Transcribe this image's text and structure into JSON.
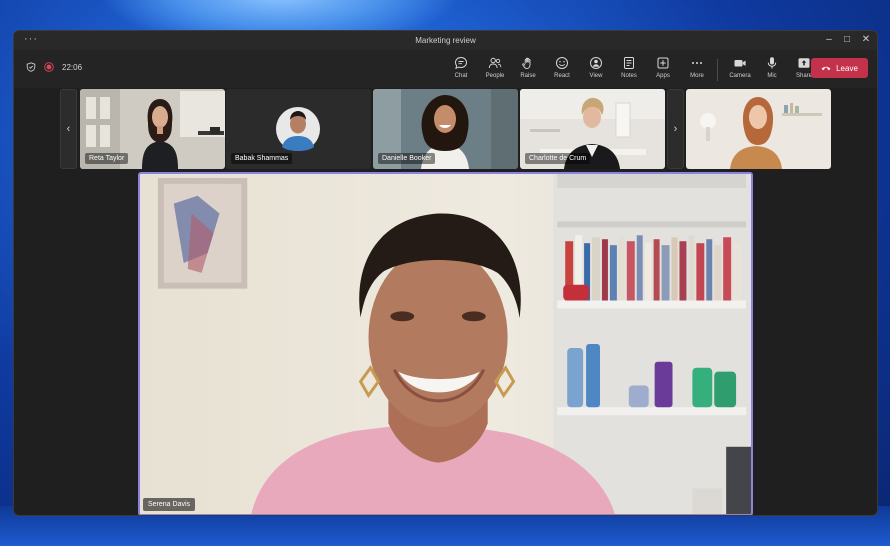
{
  "window": {
    "title": "Marketing review",
    "menu_glyph": "···",
    "minimize_glyph": "–",
    "maximize_glyph": "□",
    "close_glyph": "✕"
  },
  "call": {
    "duration": "22:06",
    "recording_color": "#e0455a"
  },
  "toolbar": {
    "buttons": [
      {
        "label": "Chat",
        "icon": "chat-icon"
      },
      {
        "label": "People",
        "icon": "people-icon"
      },
      {
        "label": "Raise",
        "icon": "raise-hand-icon"
      },
      {
        "label": "React",
        "icon": "react-icon"
      },
      {
        "label": "View",
        "icon": "view-icon"
      },
      {
        "label": "Notes",
        "icon": "notes-icon"
      },
      {
        "label": "Apps",
        "icon": "apps-icon"
      },
      {
        "label": "More",
        "icon": "more-icon"
      },
      {
        "label": "Camera",
        "icon": "camera-icon"
      },
      {
        "label": "Mic",
        "icon": "mic-icon"
      },
      {
        "label": "Share",
        "icon": "share-icon"
      }
    ],
    "leave_label": "Leave",
    "leave_color": "#c4314b"
  },
  "gallery": {
    "prev_glyph": "‹",
    "next_glyph": "›",
    "participants": [
      {
        "name": "Reta Taylor"
      },
      {
        "name": "Babak Shammas"
      },
      {
        "name": "Danielle Booker"
      },
      {
        "name": "Charlotte de Crum"
      },
      {
        "name": ""
      }
    ]
  },
  "stage": {
    "speaker_name": "Serena Davis",
    "highlight_color": "#8a84e0"
  }
}
